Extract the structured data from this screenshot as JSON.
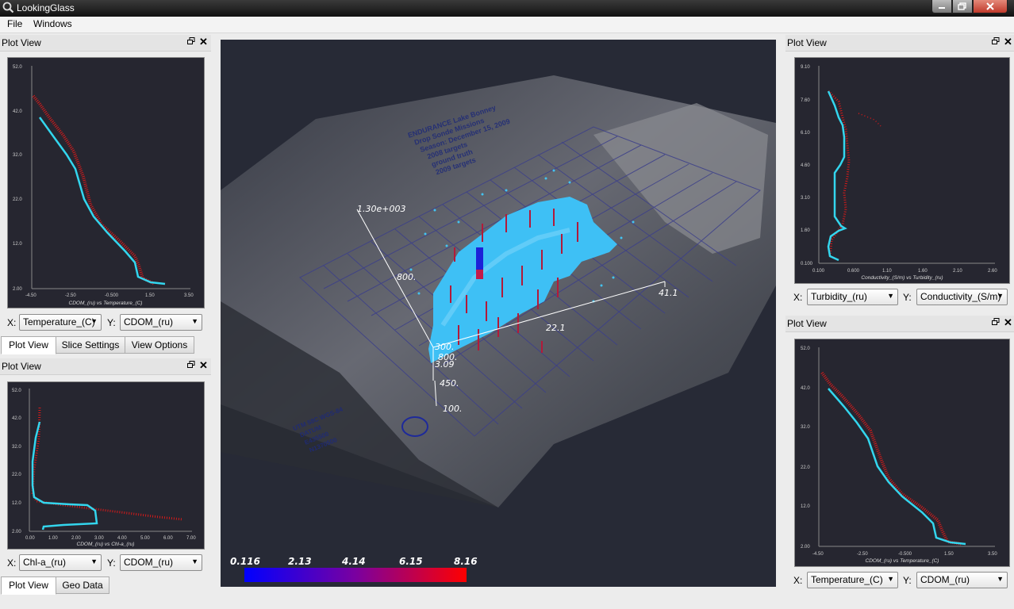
{
  "window": {
    "title": "LookingGlass"
  },
  "menu": {
    "file": "File",
    "windows": "Windows"
  },
  "left_top_dock": {
    "title": "Plot View",
    "plot": {
      "caption": "CDOM_(ru) vs Temperature_(C)",
      "yticks": [
        "52.0",
        "42.0",
        "32.0",
        "22.0",
        "12.0",
        "2.00"
      ],
      "xticks": [
        "-4.50",
        "-2.50",
        "-0.500",
        "1.50",
        "3.50"
      ]
    },
    "x_label": "X:",
    "x_value": "Temperature_(C)",
    "y_label": "Y:",
    "y_value": "CDOM_(ru)"
  },
  "left_tabs": [
    "Plot View",
    "Slice Settings",
    "View Options"
  ],
  "left_bottom_dock": {
    "title": "Plot View",
    "plot": {
      "caption": "CDOM_(ru) vs Chl-a_(ru)",
      "yticks": [
        "52.0",
        "42.0",
        "32.0",
        "22.0",
        "12.0",
        "2.00"
      ],
      "xticks": [
        "0.00",
        "1.00",
        "2.00",
        "3.00",
        "4.00",
        "5.00",
        "6.00",
        "7.00"
      ]
    },
    "x_label": "X:",
    "x_value": "Chl-a_(ru)",
    "y_label": "Y:",
    "y_value": "CDOM_(ru)"
  },
  "left_bottom_tabs": [
    "Plot View",
    "Geo Data"
  ],
  "right_top_dock": {
    "title": "Plot View",
    "plot": {
      "caption": "Conductivity_(S/m) vs Turbidity_(ru)",
      "yticks": [
        "9.10",
        "7.60",
        "6.10",
        "4.60",
        "3.10",
        "1.60",
        "0.100"
      ],
      "xticks": [
        "0.100",
        "0.600",
        "1.10",
        "1.60",
        "2.10",
        "2.60"
      ]
    },
    "x_label": "X:",
    "x_value": "Turbidity_(ru)",
    "y_label": "Y:",
    "y_value": "Conductivity_(S/m)"
  },
  "right_bottom_dock": {
    "title": "Plot View",
    "plot": {
      "caption": "CDOM_(ru) vs Temperature_(C)",
      "yticks": [
        "52.0",
        "42.0",
        "32.0",
        "22.0",
        "12.0",
        "2.00"
      ],
      "xticks": [
        "-4.50",
        "-2.50",
        "-0.500",
        "1.50",
        "3.50"
      ]
    },
    "x_label": "X:",
    "x_value": "Temperature_(C)",
    "y_label": "Y:",
    "y_value": "CDOM_(ru)"
  },
  "view3d": {
    "axis_labels": [
      "1.30e+003",
      "800.",
      "300.",
      "800.",
      "3.09",
      "450.",
      "100.",
      "22.1",
      "41.1"
    ],
    "map_text": [
      "ENDURANCE Lake Bonney",
      "Drop Sonde Missions",
      "Season: December 15, 2009",
      "2008 targets",
      "ground truth",
      "2009 targets"
    ],
    "map_legend": [
      "UTM 58C WGS-84",
      "DATUM",
      "E435500",
      "N1370500"
    ],
    "colorbar": {
      "ticks": [
        "0.116",
        "2.13",
        "4.14",
        "6.15",
        "8.16"
      ],
      "low_color": "#0000ff",
      "high_color": "#ff0000"
    }
  },
  "colors": {
    "profile": "#33d6ee",
    "scatter": "#d21a1a",
    "plume": "#3ec0f5",
    "plot_bg": "#262630"
  }
}
